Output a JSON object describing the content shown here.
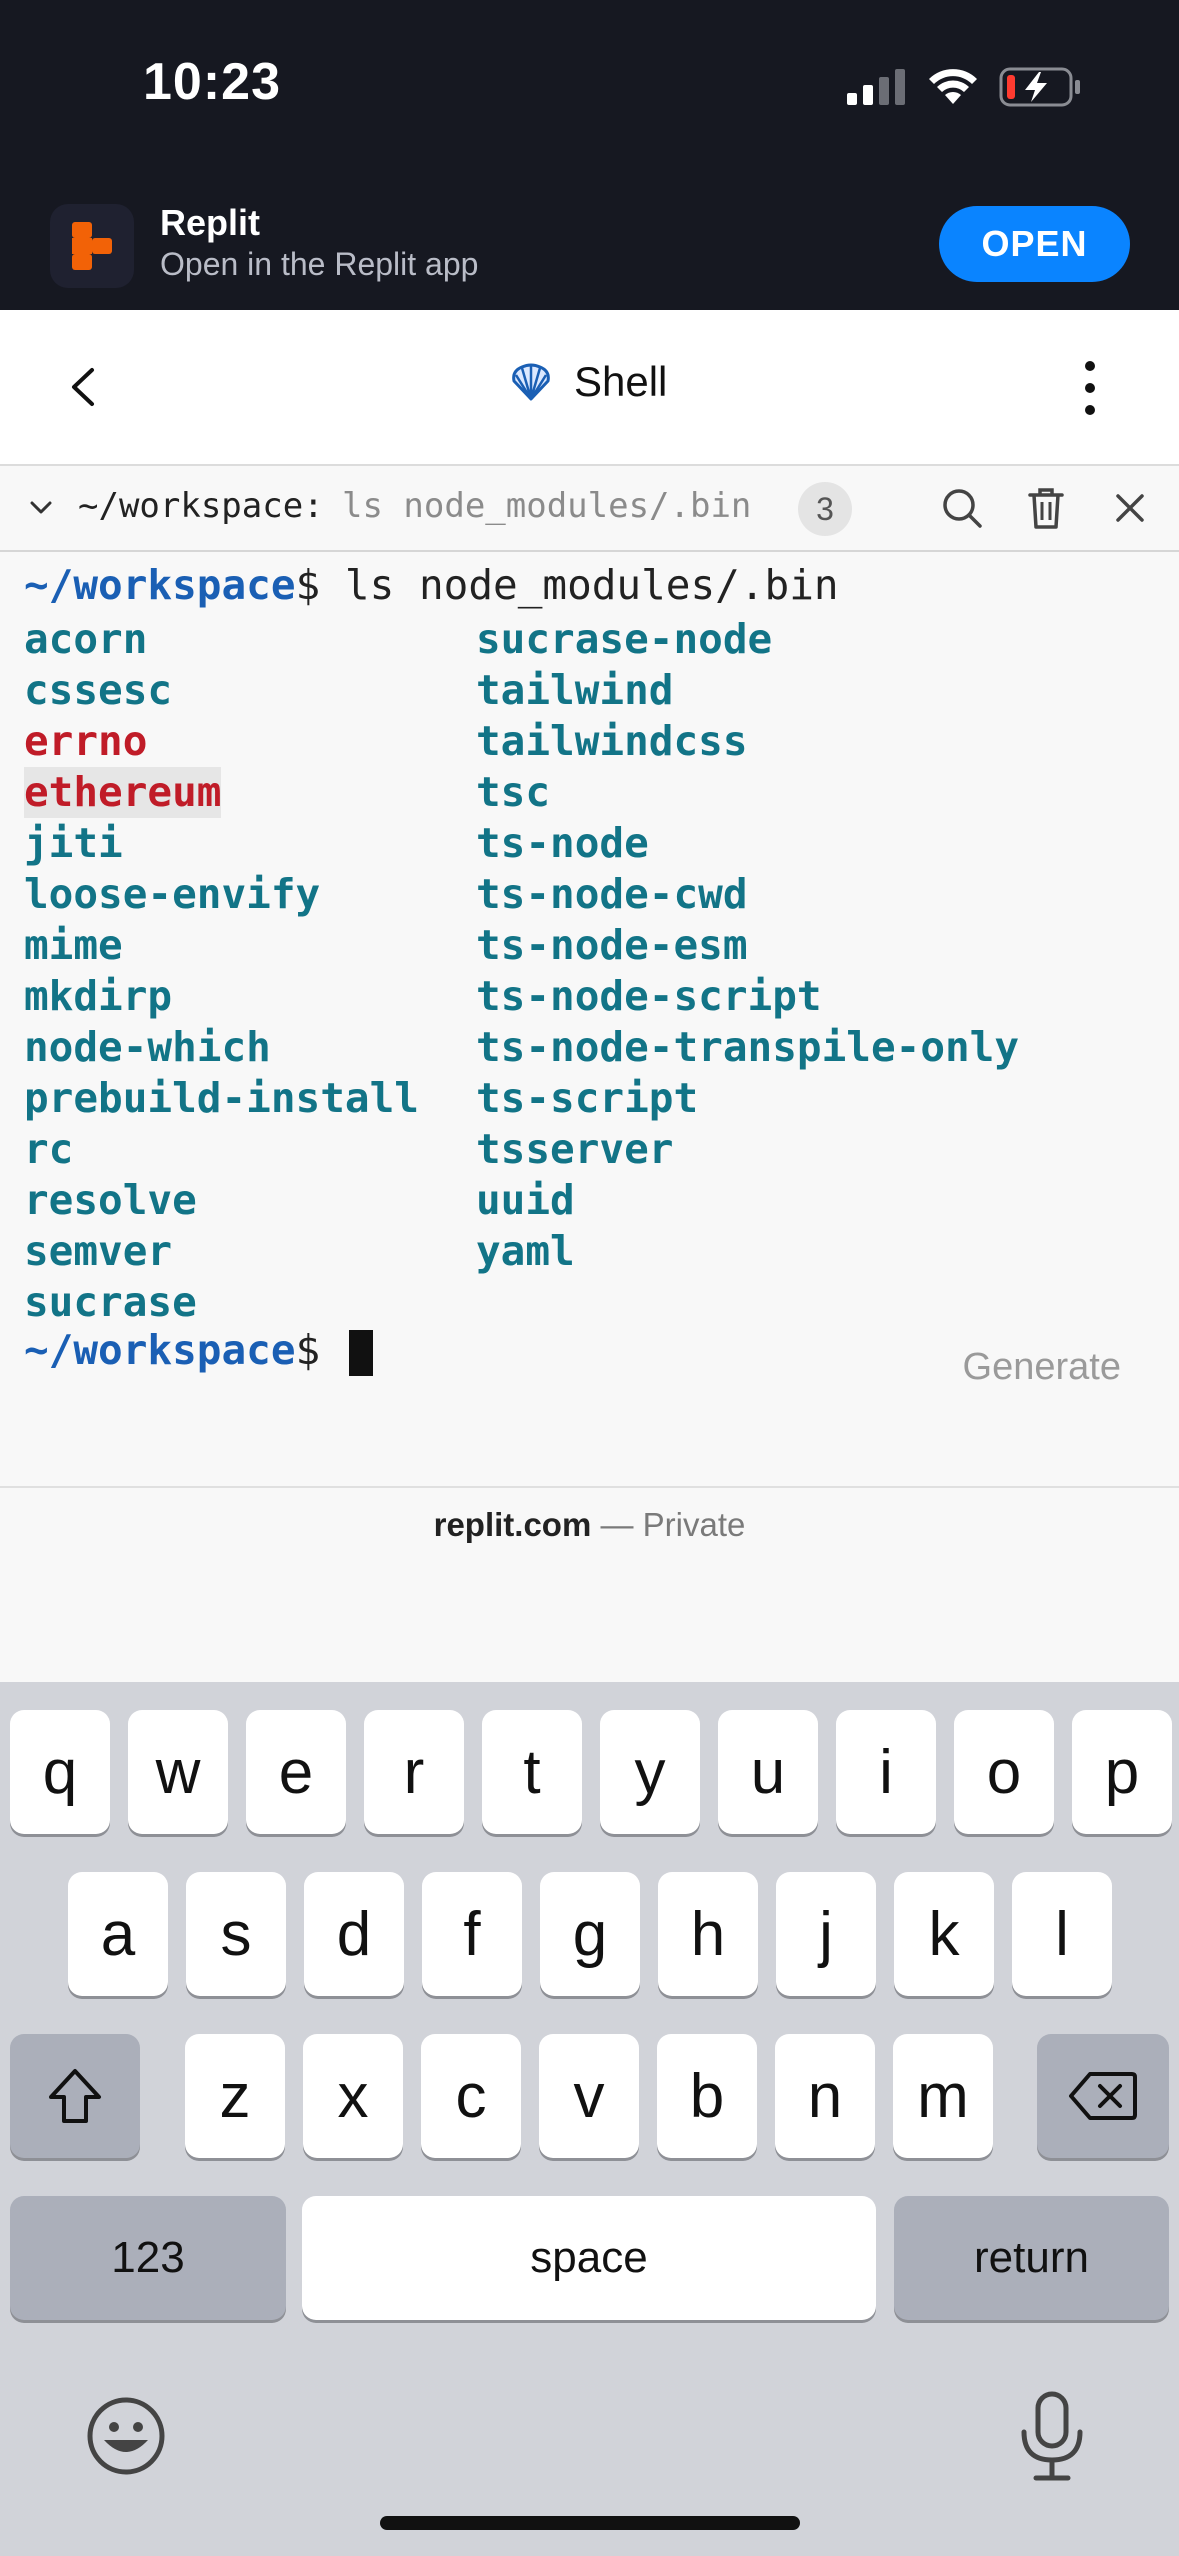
{
  "status_bar": {
    "time": "10:23"
  },
  "banner": {
    "app_name": "Replit",
    "subtitle": "Open in the Replit app",
    "open_label": "OPEN",
    "accent": "#0a84ff",
    "logo_color": "#f26207"
  },
  "nav": {
    "title": "Shell"
  },
  "terminal_toolbar": {
    "path": "~/workspace:",
    "command": "ls node_modules/.bin",
    "count": "3"
  },
  "terminal": {
    "prompt_path": "~/workspace",
    "prompt_symbol": "$",
    "command": "ls node_modules/.bin",
    "column1": [
      "acorn",
      "cssesc",
      "errno",
      "ethereum",
      "jiti",
      "loose-envify",
      "mime",
      "mkdirp",
      "node-which",
      "prebuild-install",
      "rc",
      "resolve",
      "semver",
      "sucrase"
    ],
    "column2": [
      "sucrase-node",
      "tailwind",
      "tailwindcss",
      "tsc",
      "ts-node",
      "ts-node-cwd",
      "ts-node-esm",
      "ts-node-script",
      "ts-node-transpile-only",
      "ts-script",
      "tsserver",
      "uuid",
      "yaml"
    ],
    "red_items": [
      "errno",
      "ethereum"
    ],
    "generate_label": "Generate",
    "colors": {
      "prompt": "#1a5fb4",
      "file": "#127487",
      "error": "#c01c28"
    }
  },
  "footer": {
    "domain": "replit.com",
    "separator": "—",
    "privacy": "Private"
  },
  "keyboard": {
    "row1": [
      "q",
      "w",
      "e",
      "r",
      "t",
      "y",
      "u",
      "i",
      "o",
      "p"
    ],
    "row2": [
      "a",
      "s",
      "d",
      "f",
      "g",
      "h",
      "j",
      "k",
      "l"
    ],
    "row3": [
      "z",
      "x",
      "c",
      "v",
      "b",
      "n",
      "m"
    ],
    "numbers_label": "123",
    "space_label": "space",
    "return_label": "return"
  }
}
